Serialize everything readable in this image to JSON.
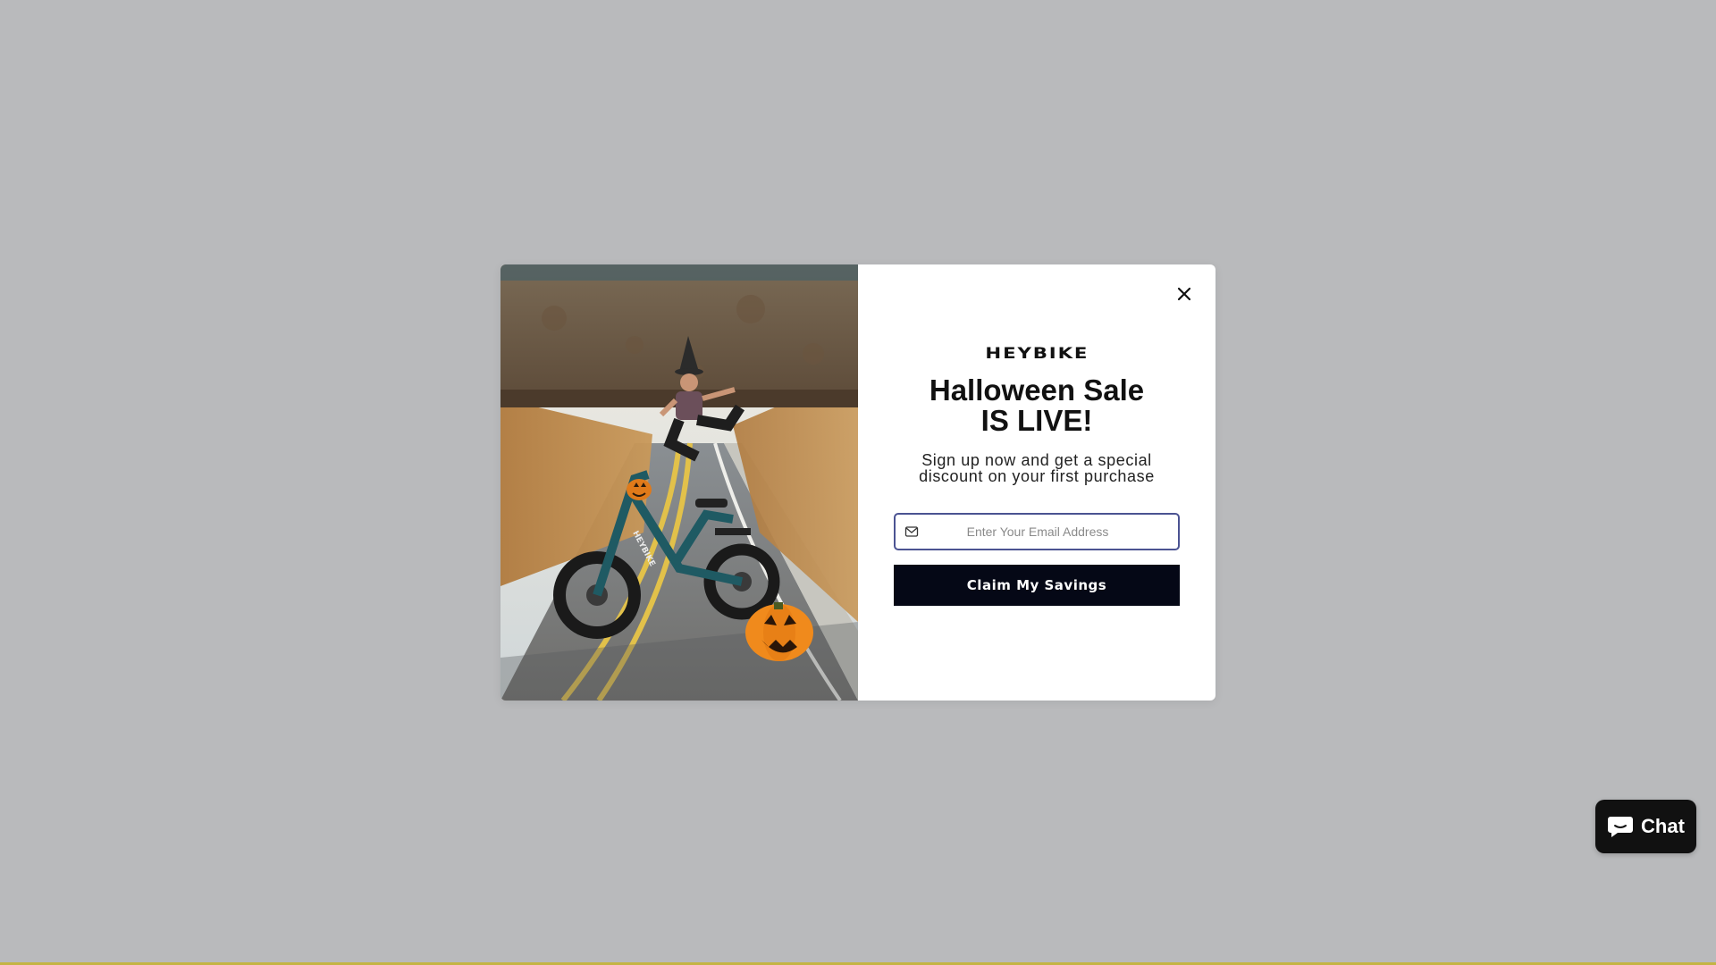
{
  "popup": {
    "brand": "HEYBIKE",
    "headline_line1": "Halloween Sale",
    "headline_line2": "IS LIVE!",
    "subtext_line1": "Sign up now and get a special",
    "subtext_line2": "discount on your first purchase",
    "email": {
      "placeholder": "Enter Your Email Address",
      "value": ""
    },
    "cta_label": "Claim My Savings",
    "close_icon": "close-icon",
    "hero_image": {
      "description_icon": "halloween-ebike-photo",
      "bike_brand": "HEYBIKE"
    }
  },
  "chat": {
    "label": "Chat",
    "icon": "chat-bubble-icon"
  },
  "colors": {
    "overlay": "#b9babc",
    "cta_background": "#050816",
    "input_border": "#4b5392",
    "chat_background": "#111111",
    "accent_bar": "#c4b444"
  }
}
